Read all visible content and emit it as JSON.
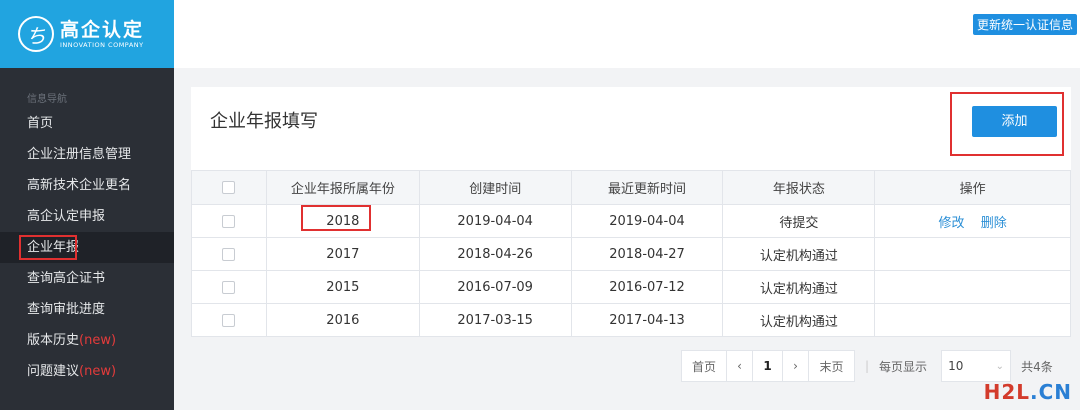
{
  "app": {
    "logo_mark": "ち",
    "logo_title": "高企认定",
    "logo_subtitle": "INNOVATION COMPANY"
  },
  "topbar": {
    "update_link": "更新统一认证信息"
  },
  "sidebar": {
    "caption": "信息导航",
    "items": [
      {
        "label": "首页"
      },
      {
        "label": "企业注册信息管理"
      },
      {
        "label": "高新技术企业更名"
      },
      {
        "label": "高企认定申报"
      },
      {
        "label": "企业年报",
        "active": true
      },
      {
        "label": "查询高企证书"
      },
      {
        "label": "查询审批进度"
      },
      {
        "label": "版本历史",
        "tag": "(new)"
      },
      {
        "label": "问题建议",
        "tag": "(new)"
      }
    ]
  },
  "panel": {
    "title": "企业年报填写",
    "add_label": "添加",
    "table": {
      "headers": [
        "",
        "企业年报所属年份",
        "创建时间",
        "最近更新时间",
        "年报状态",
        "操作"
      ],
      "rows": [
        {
          "year": "2018",
          "created": "2019-04-04",
          "updated": "2019-04-04",
          "status": "待提交",
          "edit": "修改",
          "delete": "删除"
        },
        {
          "year": "2017",
          "created": "2018-04-26",
          "updated": "2018-04-27",
          "status": "认定机构通过"
        },
        {
          "year": "2015",
          "created": "2016-07-09",
          "updated": "2016-07-12",
          "status": "认定机构通过"
        },
        {
          "year": "2016",
          "created": "2017-03-15",
          "updated": "2017-04-13",
          "status": "认定机构通过"
        }
      ]
    }
  },
  "pagination": {
    "first": "首页",
    "prev": "‹",
    "current": "1",
    "next": "›",
    "last": "末页",
    "separator": "|",
    "per_page_label": "每页显示",
    "per_page_value": "10",
    "total": "共4条"
  },
  "watermark": {
    "part1": "H2L",
    "part2": ".CN"
  },
  "colors": {
    "accent": "#1f8fe0",
    "logo_bg": "#21a4e0",
    "sidebar_bg": "#2b2f36",
    "highlight": "#e03030"
  }
}
